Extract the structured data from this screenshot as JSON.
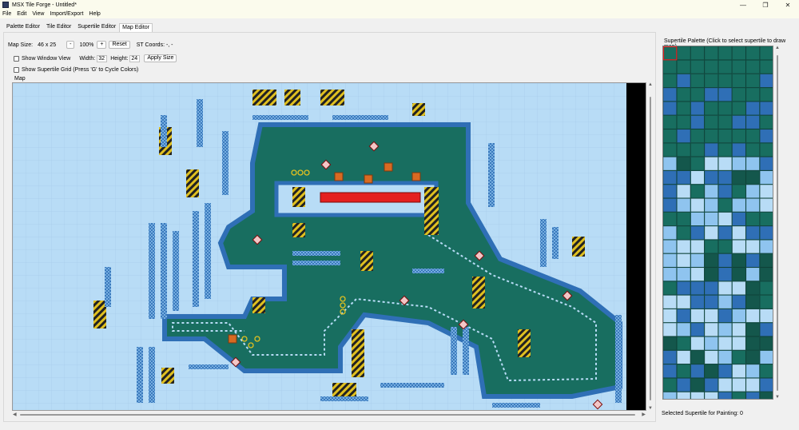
{
  "window": {
    "title": "MSX Tile Forge - Untitled*",
    "minimize": "—",
    "maximize": "❐",
    "close": "✕"
  },
  "menu": [
    "File",
    "Edit",
    "View",
    "Import/Export",
    "Help"
  ],
  "tabs": [
    {
      "label": "Palette Editor",
      "active": false
    },
    {
      "label": "Tile Editor",
      "active": false
    },
    {
      "label": "Supertile Editor",
      "active": false
    },
    {
      "label": "Map Editor",
      "active": true
    }
  ],
  "controls": {
    "map_size_label": "Map Size:",
    "map_size_value": "46 x 25",
    "zoom_out": "-",
    "zoom_level": "100%",
    "zoom_in": "+",
    "reset": "Reset",
    "st_coords": "ST Coords: -, -",
    "show_window_view": "Show Window View",
    "width_label": "Width:",
    "width_value": "32",
    "height_label": "Height:",
    "height_value": "24",
    "apply_size": "Apply Size",
    "show_supertile_grid": "Show Supertile Grid (Press 'G' to Cycle Colors)"
  },
  "map": {
    "label": "Map",
    "colors": {
      "background": "#b8dcf6",
      "floor": "#186e60",
      "wall": "#2f6fb6",
      "hazard": "#e42020",
      "stripe": "#e0c020",
      "crate": "#d86a22"
    }
  },
  "supertile_palette": {
    "title": "Supertile Palette (Click to select supertile to draw map)",
    "status": "Selected Supertile for Painting: 0",
    "selected_color": "#e02020"
  }
}
